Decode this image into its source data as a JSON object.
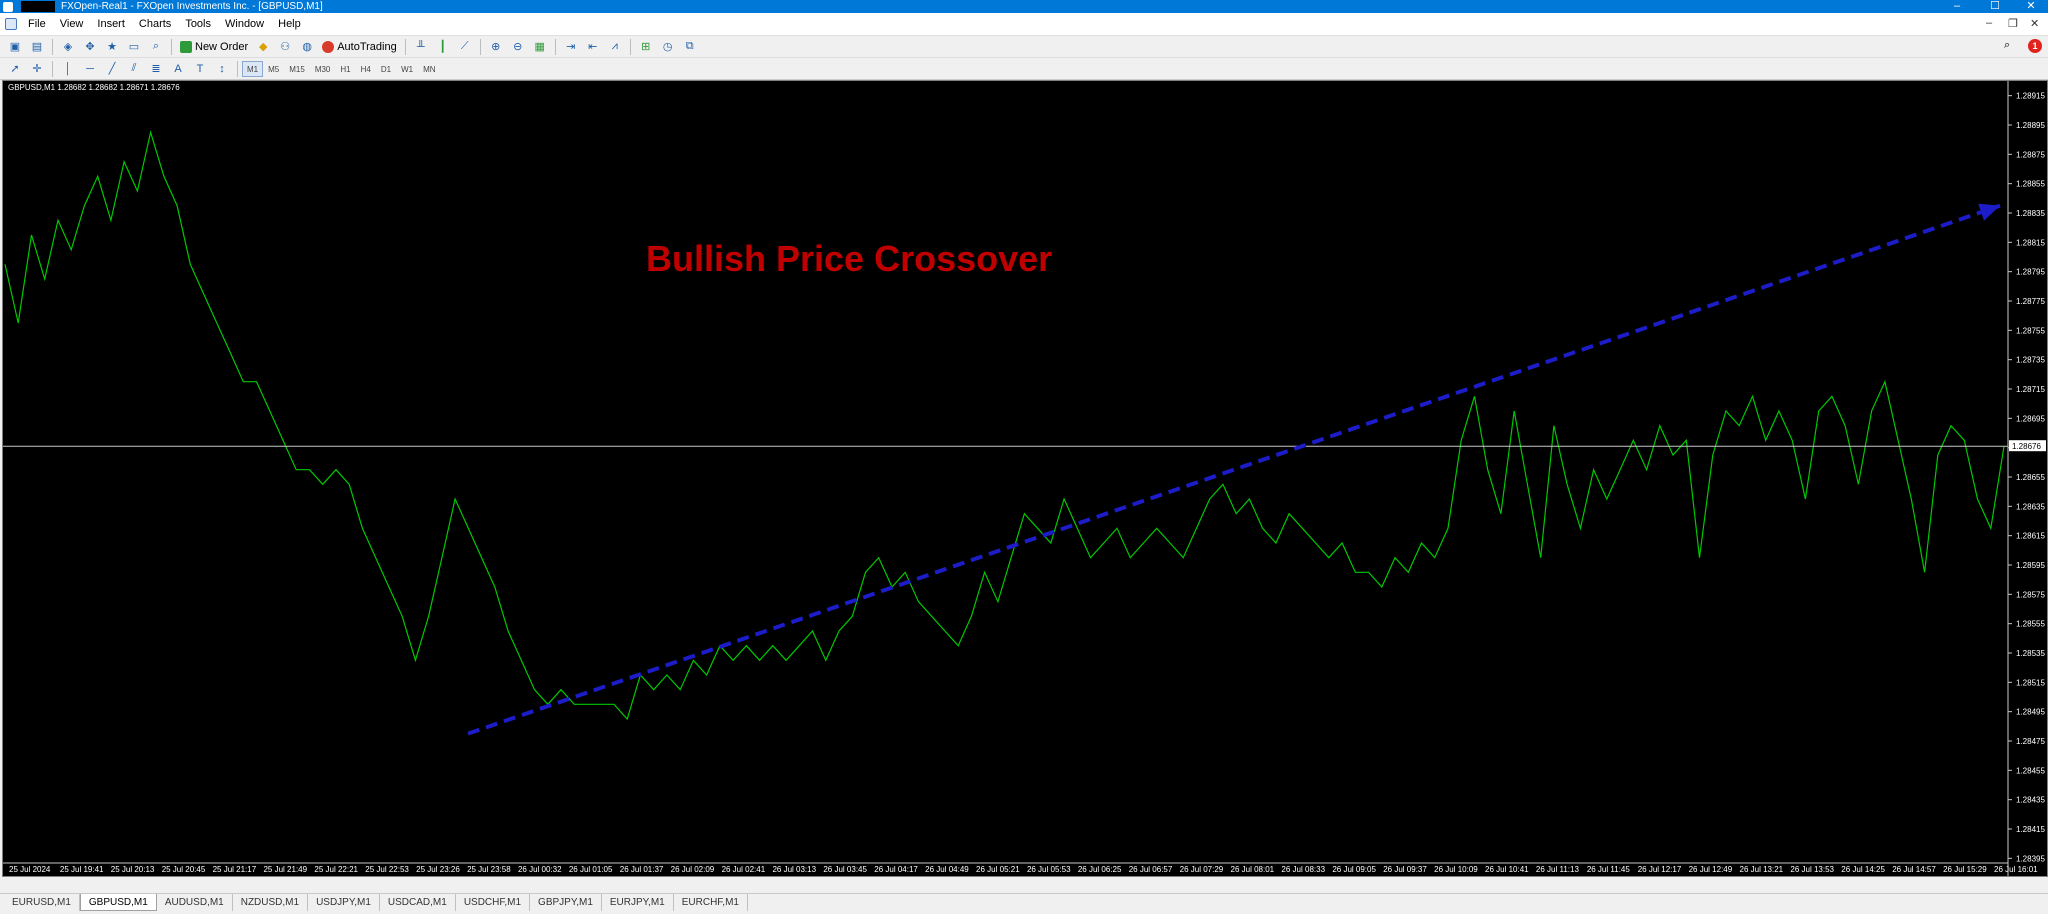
{
  "window": {
    "title": "FXOpen-Real1 - FXOpen Investments Inc. - [GBPUSD,M1]",
    "controls": [
      "–",
      "☐",
      "✕"
    ]
  },
  "menu": {
    "items": [
      "File",
      "View",
      "Insert",
      "Charts",
      "Tools",
      "Window",
      "Help"
    ],
    "mdi_controls": [
      "–",
      "❐",
      "✕"
    ]
  },
  "toolbar": {
    "new_order_label": "New Order",
    "autotrading_label": "AutoTrading",
    "notification_count": "1",
    "timeframes": [
      "M1",
      "M5",
      "M15",
      "M30",
      "H1",
      "H4",
      "D1",
      "W1",
      "MN"
    ],
    "active_timeframe": "M1",
    "colors": {
      "new_order": "#2e9a3a",
      "autotrading": "#d83a2c"
    }
  },
  "chart": {
    "symbol_info": "GBPUSD,M1  1.28682 1.28682 1.28671 1.28676",
    "annotation": "Bullish Price Crossover",
    "current_price_label": "1.28676",
    "colors": {
      "background": "#000000",
      "price_line": "#00c800",
      "trend_arrow": "#1c1cc8",
      "annotation_text": "#c00000",
      "bid_line": "#c8c8c8"
    }
  },
  "chart_data": {
    "type": "line",
    "ylim": [
      1.28385,
      1.28925
    ],
    "y_ticks": [
      "1.28915",
      "1.28895",
      "1.28875",
      "1.28855",
      "1.28835",
      "1.28815",
      "1.28795",
      "1.28775",
      "1.28755",
      "1.28735",
      "1.28715",
      "1.28695",
      "1.28675",
      "1.28655",
      "1.28635",
      "1.28615",
      "1.28595",
      "1.28575",
      "1.28555",
      "1.28535",
      "1.28515",
      "1.28495",
      "1.28475",
      "1.28455",
      "1.28435",
      "1.28415",
      "1.28395"
    ],
    "x_ticks": [
      "25 Jul 2024",
      "25 Jul 19:41",
      "25 Jul 20:13",
      "25 Jul 20:45",
      "25 Jul 21:17",
      "25 Jul 21:49",
      "25 Jul 22:21",
      "25 Jul 22:53",
      "25 Jul 23:26",
      "25 Jul 23:58",
      "26 Jul 00:32",
      "26 Jul 01:05",
      "26 Jul 01:37",
      "26 Jul 02:09",
      "26 Jul 02:41",
      "26 Jul 03:13",
      "26 Jul 03:45",
      "26 Jul 04:17",
      "26 Jul 04:49",
      "26 Jul 05:21",
      "26 Jul 05:53",
      "26 Jul 06:25",
      "26 Jul 06:57",
      "26 Jul 07:29",
      "26 Jul 08:01",
      "26 Jul 08:33",
      "26 Jul 09:05",
      "26 Jul 09:37",
      "26 Jul 10:09",
      "26 Jul 10:41",
      "26 Jul 11:13",
      "26 Jul 11:45",
      "26 Jul 12:17",
      "26 Jul 12:49",
      "26 Jul 13:21",
      "26 Jul 13:53",
      "26 Jul 14:25",
      "26 Jul 14:57",
      "26 Jul 15:29",
      "26 Jul 16:01"
    ],
    "current_price": 1.28676,
    "series": [
      {
        "values": [
          1.288,
          1.2876,
          1.2882,
          1.2879,
          1.2883,
          1.2881,
          1.2884,
          1.2886,
          1.2883,
          1.2887,
          1.2885,
          1.2889,
          1.2886,
          1.2884,
          1.288,
          1.2878,
          1.2876,
          1.2874,
          1.2872,
          1.2872,
          1.287,
          1.2868,
          1.2866,
          1.2866,
          1.2865,
          1.2866,
          1.2865,
          1.2862,
          1.286,
          1.2858,
          1.2856,
          1.2853,
          1.2856,
          1.286,
          1.2864,
          1.2862,
          1.286,
          1.2858,
          1.2855,
          1.2853,
          1.2851,
          1.285,
          1.2851,
          1.285,
          1.285,
          1.285,
          1.285,
          1.2849,
          1.2852,
          1.2851,
          1.2852,
          1.2851,
          1.2853,
          1.2852,
          1.2854,
          1.2853,
          1.2854,
          1.2853,
          1.2854,
          1.2853,
          1.2854,
          1.2855,
          1.2853,
          1.2855,
          1.2856,
          1.2859,
          1.286,
          1.2858,
          1.2859,
          1.2857,
          1.2856,
          1.2855,
          1.2854,
          1.2856,
          1.2859,
          1.2857,
          1.286,
          1.2863,
          1.2862,
          1.2861,
          1.2864,
          1.2862,
          1.286,
          1.2861,
          1.2862,
          1.286,
          1.2861,
          1.2862,
          1.2861,
          1.286,
          1.2862,
          1.2864,
          1.2865,
          1.2863,
          1.2864,
          1.2862,
          1.2861,
          1.2863,
          1.2862,
          1.2861,
          1.286,
          1.2861,
          1.2859,
          1.2859,
          1.2858,
          1.286,
          1.2859,
          1.2861,
          1.286,
          1.2862,
          1.2868,
          1.2871,
          1.2866,
          1.2863,
          1.287,
          1.2865,
          1.286,
          1.2869,
          1.2865,
          1.2862,
          1.2866,
          1.2864,
          1.2866,
          1.2868,
          1.2866,
          1.2869,
          1.2867,
          1.2868,
          1.286,
          1.2867,
          1.287,
          1.2869,
          1.2871,
          1.2868,
          1.287,
          1.2868,
          1.2864,
          1.287,
          1.2871,
          1.2869,
          1.2865,
          1.287,
          1.2872,
          1.2868,
          1.2864,
          1.2859,
          1.2867,
          1.2869,
          1.2868,
          1.2864,
          1.2862,
          1.28676
        ]
      }
    ],
    "trend_arrow": {
      "from_price": 1.2848,
      "to_price": 1.2884
    }
  },
  "tabs": [
    "EURUSD,M1",
    "GBPUSD,M1",
    "AUDUSD,M1",
    "NZDUSD,M1",
    "USDJPY,M1",
    "USDCAD,M1",
    "USDCHF,M1",
    "GBPJPY,M1",
    "EURJPY,M1",
    "EURCHF,M1"
  ],
  "active_tab": "GBPUSD,M1"
}
